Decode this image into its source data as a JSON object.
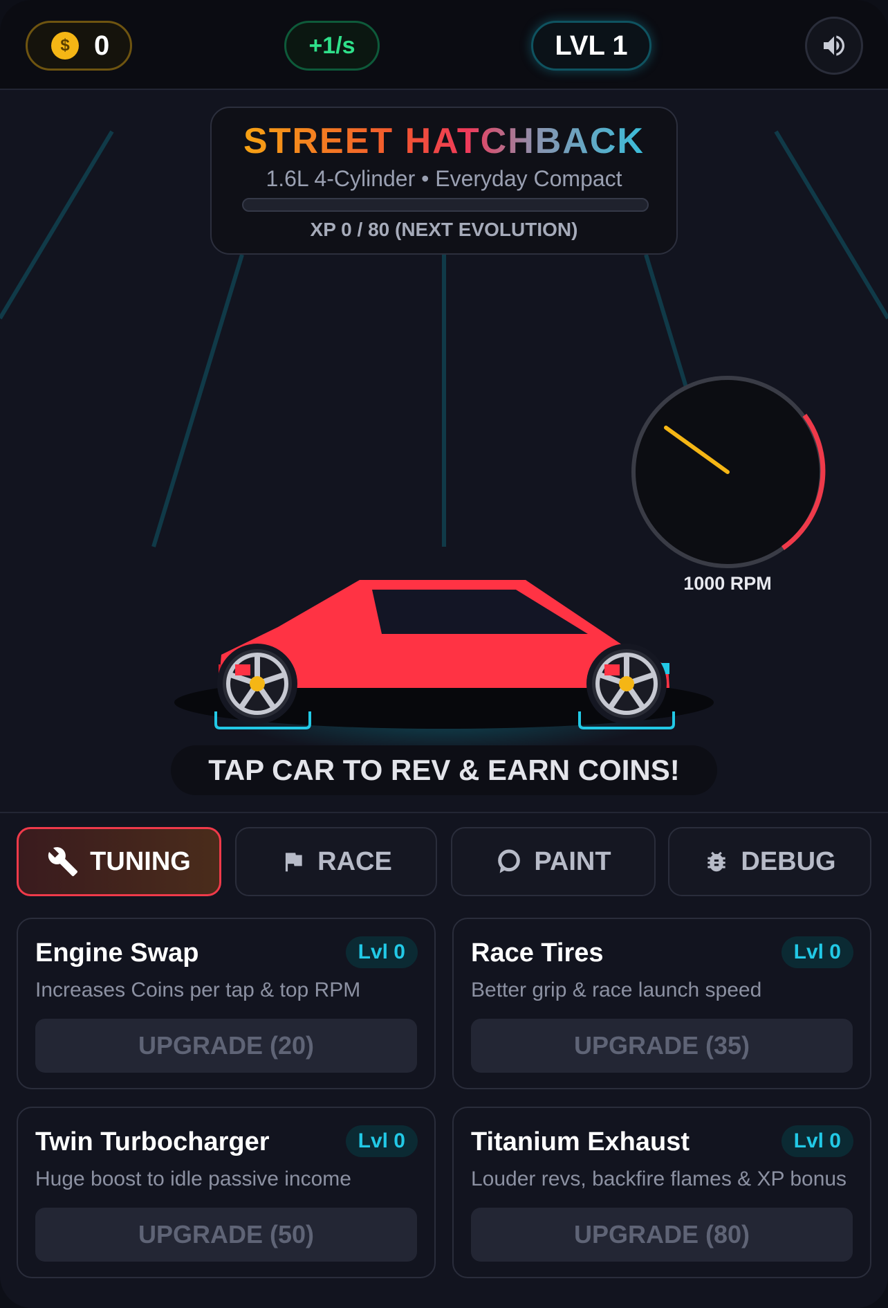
{
  "hud": {
    "coins": "0",
    "rate": "+1/s",
    "level": "LVL 1"
  },
  "car": {
    "name": "STREET HATCHBACK",
    "subtitle": "1.6L 4-Cylinder • Everyday Compact",
    "xp_text": "XP 0 / 80 (NEXT EVOLUTION)",
    "xp_progress": 0,
    "color": "#ff3344"
  },
  "gauge": {
    "rpm_label": "1000 RPM"
  },
  "prompt": "TAP CAR TO REV & EARN COINS!",
  "tabs": [
    {
      "label": "TUNING",
      "icon": "wrench-icon",
      "active": true
    },
    {
      "label": "RACE",
      "icon": "flag-icon",
      "active": false
    },
    {
      "label": "PAINT",
      "icon": "paint-icon",
      "active": false
    },
    {
      "label": "DEBUG",
      "icon": "bug-icon",
      "active": false
    }
  ],
  "upgrades": [
    {
      "title": "Engine Swap",
      "level": "Lvl 0",
      "desc": "Increases Coins per tap & top RPM",
      "button": "UPGRADE (20)"
    },
    {
      "title": "Race Tires",
      "level": "Lvl 0",
      "desc": "Better grip & race launch speed",
      "button": "UPGRADE (35)"
    },
    {
      "title": "Twin Turbocharger",
      "level": "Lvl 0",
      "desc": "Huge boost to idle passive income",
      "button": "UPGRADE (50)"
    },
    {
      "title": "Titanium Exhaust",
      "level": "Lvl 0",
      "desc": "Louder revs, backfire flames & XP bonus",
      "button": "UPGRADE (80)"
    }
  ],
  "colors": {
    "accent_cyan": "#22c9e6",
    "accent_red": "#ef3a4a",
    "coin_gold": "#f5b615",
    "rate_green": "#2fe08a"
  }
}
